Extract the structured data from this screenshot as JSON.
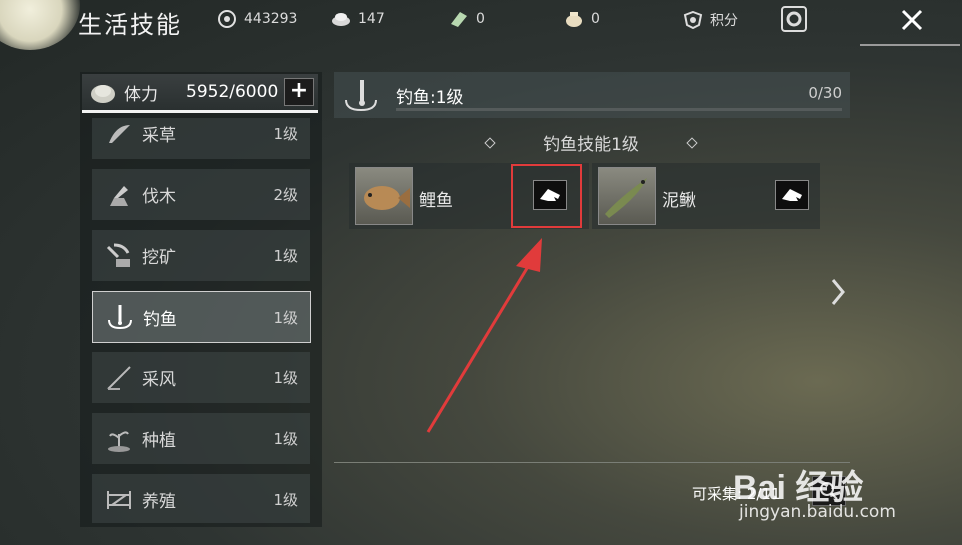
{
  "app_title": "生活技能",
  "stats": [
    {
      "icon": "coin-icon",
      "value": "443293"
    },
    {
      "icon": "silver-icon",
      "value": "147"
    },
    {
      "icon": "ticket-icon",
      "value": "0"
    },
    {
      "icon": "pouch-icon",
      "value": "0"
    },
    {
      "icon": "shield-icon",
      "value": "积分"
    }
  ],
  "stamina": {
    "label": "体力",
    "value": "5952/6000",
    "plus": "+"
  },
  "skills": [
    {
      "icon": "herb-icon",
      "name": "采草",
      "level": "1级"
    },
    {
      "icon": "axe-icon",
      "name": "伐木",
      "level": "2级"
    },
    {
      "icon": "pickaxe-icon",
      "name": "挖矿",
      "level": "1级"
    },
    {
      "icon": "fishing-icon",
      "name": "钓鱼",
      "level": "1级",
      "active": true
    },
    {
      "icon": "wind-icon",
      "name": "采风",
      "level": "1级"
    },
    {
      "icon": "plant-icon",
      "name": "种植",
      "level": "1级"
    },
    {
      "icon": "farm-icon",
      "name": "养殖",
      "level": "1级"
    }
  ],
  "header": {
    "title": "钓鱼:1级",
    "progress": "0/30"
  },
  "section_title": "钓鱼技能1级",
  "fish": [
    {
      "name": "鲤鱼",
      "icon": "carp-icon"
    },
    {
      "name": "泥鳅",
      "icon": "loach-icon"
    }
  ],
  "collect": "可采集: 2/11",
  "watermark": {
    "brand": "Bai 经验",
    "url": "jingyan.baidu.com"
  },
  "colors": {
    "highlight": "#e13b3b",
    "arrow": "#e13b3b"
  }
}
